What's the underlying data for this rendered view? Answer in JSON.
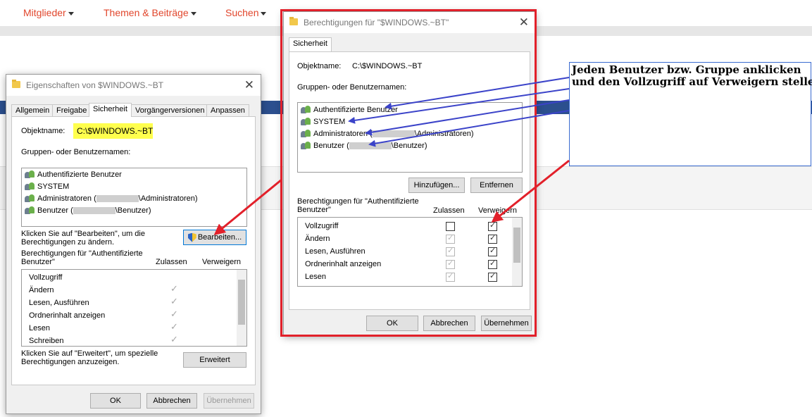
{
  "site_nav": {
    "items": [
      "Mitglieder",
      "Themen & Beiträge",
      "Suchen"
    ]
  },
  "window1": {
    "title": "Eigenschaften von $WINDOWS.~BT",
    "tabs": [
      "Allgemein",
      "Freigabe",
      "Sicherheit",
      "Vorgängerversionen",
      "Anpassen"
    ],
    "active_tab": "Sicherheit",
    "object_label": "Objektname:",
    "object_value": "C:\\$WINDOWS.~BT",
    "groups_label": "Gruppen- oder Benutzernamen:",
    "users": [
      {
        "pre": "Authentifizierte Benutzer",
        "post": ""
      },
      {
        "pre": "SYSTEM",
        "post": ""
      },
      {
        "pre": "Administratoren (",
        "post": "\\Administratoren)"
      },
      {
        "pre": "Benutzer (",
        "post": "\\Benutzer)"
      }
    ],
    "edit_hint_line1": "Klicken Sie auf \"Bearbeiten\", um die",
    "edit_hint_line2": "Berechtigungen zu ändern.",
    "edit_button": "Bearbeiten...",
    "perm_for_line1": "Berechtigungen für \"Authentifizierte",
    "perm_for_line2": "Benutzer\"",
    "col_allow": "Zulassen",
    "col_deny": "Verweigern",
    "permissions": [
      "Vollzugriff",
      "Ändern",
      "Lesen, Ausführen",
      "Ordnerinhalt anzeigen",
      "Lesen",
      "Schreiben"
    ],
    "advanced_hint_line1": "Klicken Sie auf \"Erweitert\", um spezielle",
    "advanced_hint_line2": "Berechtigungen anzuzeigen.",
    "advanced_button": "Erweitert",
    "ok": "OK",
    "cancel": "Abbrechen",
    "apply": "Übernehmen"
  },
  "window2": {
    "title": "Berechtigungen für \"$WINDOWS.~BT\"",
    "tab": "Sicherheit",
    "object_label": "Objektname:",
    "object_value": "C:\\$WINDOWS.~BT",
    "groups_label": "Gruppen- oder Benutzernamen:",
    "users": [
      {
        "pre": "Authentifizierte Benutzer",
        "post": ""
      },
      {
        "pre": "SYSTEM",
        "post": ""
      },
      {
        "pre": "Administratoren (",
        "post": "\\Administratoren)"
      },
      {
        "pre": "Benutzer (",
        "post": "\\Benutzer)"
      }
    ],
    "add_button": "Hinzufügen...",
    "remove_button": "Entfernen",
    "perm_for_line1": "Berechtigungen für \"Authentifizierte",
    "perm_for_line2": "Benutzer\"",
    "col_allow": "Zulassen",
    "col_deny": "Verweigern",
    "permissions": [
      "Vollzugriff",
      "Ändern",
      "Lesen, Ausführen",
      "Ordnerinhalt anzeigen",
      "Lesen"
    ],
    "ok": "OK",
    "cancel": "Abbrechen",
    "apply": "Übernehmen"
  },
  "annotation": {
    "line1": "Jeden Benutzer bzw. Gruppe anklicken",
    "line2": "und den Vollzugriff auf Verweigern stellen"
  },
  "colors": {
    "frame": "#e2202a",
    "arrow_blue": "#3b43c9",
    "highlight": "#ffff4d",
    "nav": "#e1462c"
  }
}
